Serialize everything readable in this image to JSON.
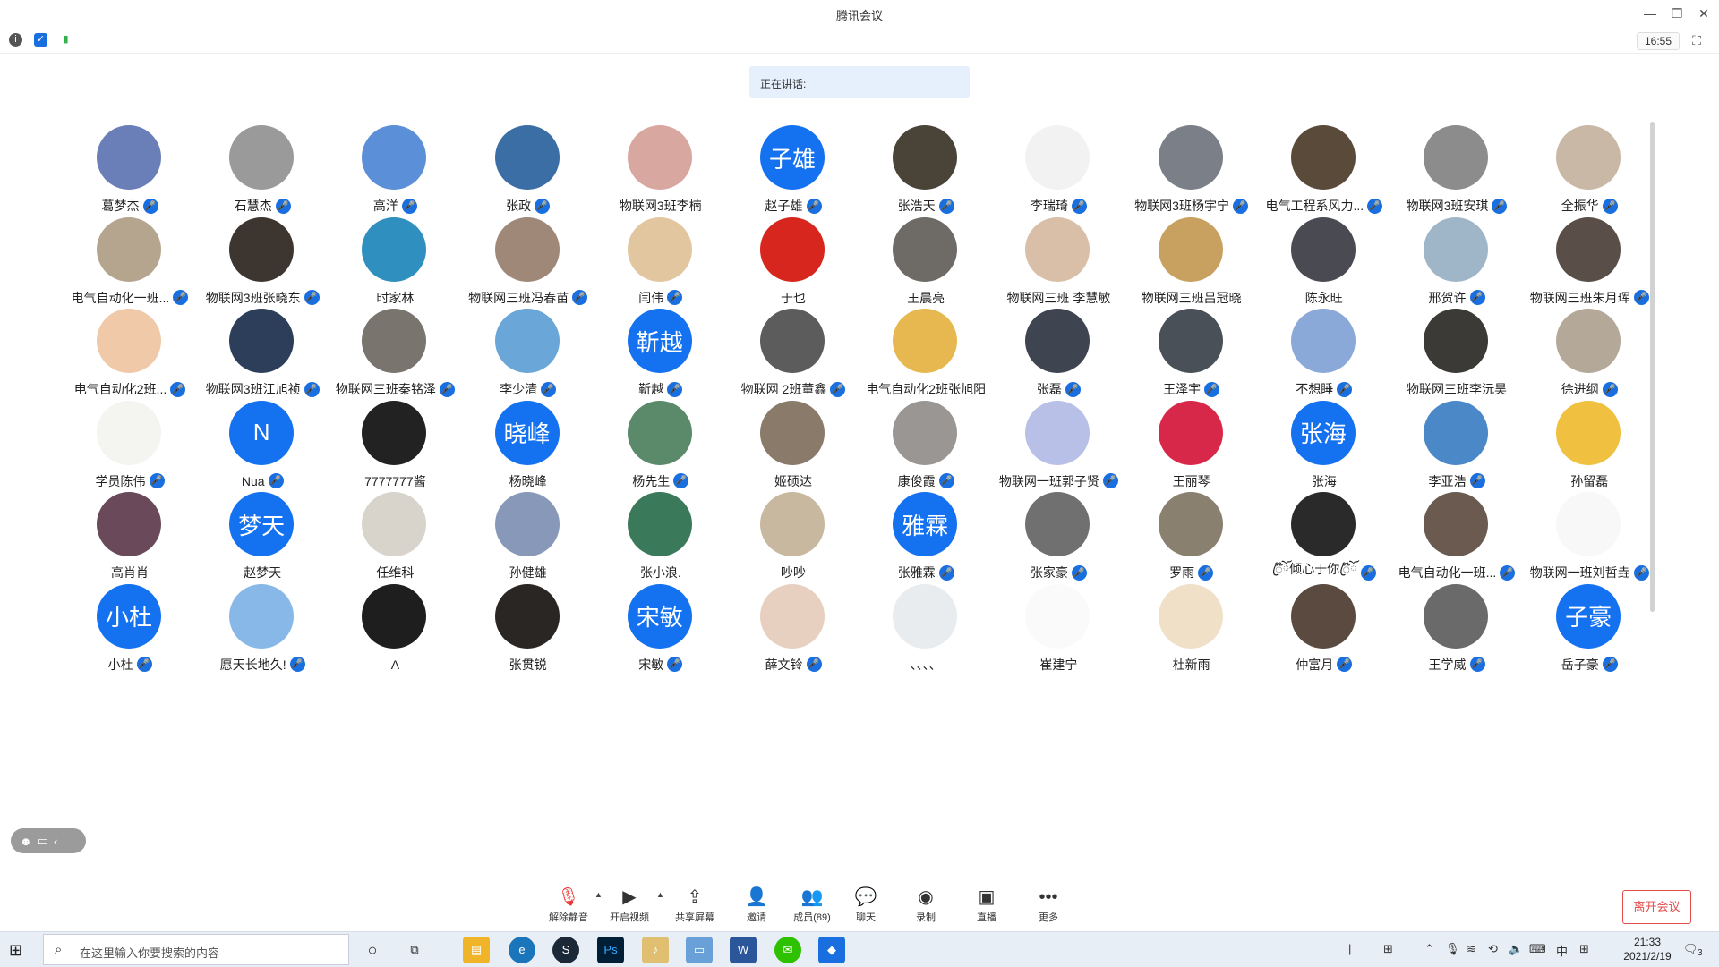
{
  "window": {
    "title": "腾讯会议",
    "minimize": "—",
    "restore": "❐",
    "close": "✕"
  },
  "infobar": {
    "clock": "16:55"
  },
  "speaking": {
    "label": "正在讲话:"
  },
  "participants": [
    {
      "name": "葛梦杰",
      "mic": true,
      "bg": "#6a7fb8"
    },
    {
      "name": "石慧杰",
      "mic": true,
      "bg": "#9a9a9a"
    },
    {
      "name": "高洋",
      "mic": true,
      "bg": "#5b8fd8"
    },
    {
      "name": "张政",
      "mic": true,
      "bg": "#3a6ea5"
    },
    {
      "name": "物联网3班李楠",
      "mic": false,
      "bg": "#d8a7a0"
    },
    {
      "name": "赵子雄",
      "mic": true,
      "avatar_text": "子雄"
    },
    {
      "name": "张浩天",
      "mic": true,
      "bg": "#4a4438"
    },
    {
      "name": "李瑞琦",
      "mic": true,
      "bg": "#f2f2f2"
    },
    {
      "name": "物联网3班杨宇宁",
      "mic": true,
      "bg": "#7b8088"
    },
    {
      "name": "电气工程系风力...",
      "mic": true,
      "bg": "#5a4a3a"
    },
    {
      "name": "物联网3班安琪",
      "mic": true,
      "bg": "#8c8c8c"
    },
    {
      "name": "全振华",
      "mic": true,
      "bg": "#c9b8a6"
    },
    {
      "name": "电气自动化一班...",
      "mic": true,
      "bg": "#b5a58f"
    },
    {
      "name": "物联网3班张晓东",
      "mic": true,
      "bg": "#3d3530"
    },
    {
      "name": "时家林",
      "mic": false,
      "bg": "#2f8fbf"
    },
    {
      "name": "物联网三班冯春苗",
      "mic": true,
      "bg": "#a08878"
    },
    {
      "name": "闫伟",
      "mic": true,
      "bg": "#e2c6a0"
    },
    {
      "name": "于也",
      "mic": false,
      "bg": "#d7261e"
    },
    {
      "name": "王晨亮",
      "mic": false,
      "bg": "#6e6a66"
    },
    {
      "name": "物联网三班 李慧敏",
      "mic": false,
      "bg": "#d9bfa8"
    },
    {
      "name": "物联网三班吕冠晓",
      "mic": false,
      "bg": "#c8a060"
    },
    {
      "name": "陈永旺",
      "mic": false,
      "bg": "#4a4a52"
    },
    {
      "name": "邢贺许",
      "mic": true,
      "bg": "#9fb6c8"
    },
    {
      "name": "物联网三班朱月珲",
      "mic": true,
      "bg": "#5a4e48"
    },
    {
      "name": "电气自动化2班...",
      "mic": true,
      "bg": "#f0c9a8"
    },
    {
      "name": "物联网3班江旭祯",
      "mic": true,
      "bg": "#2c3e5a"
    },
    {
      "name": "物联网三班秦铭泽",
      "mic": true,
      "bg": "#7a746e"
    },
    {
      "name": "李少清",
      "mic": true,
      "bg": "#6aa6d8"
    },
    {
      "name": "靳越",
      "mic": true,
      "avatar_text": "靳越"
    },
    {
      "name": "物联网 2班董鑫",
      "mic": true,
      "bg": "#5c5c5c"
    },
    {
      "name": "电气自动化2班张旭阳",
      "mic": false,
      "bg": "#e8b850"
    },
    {
      "name": "张磊",
      "mic": true,
      "bg": "#3e4450"
    },
    {
      "name": "王泽宇",
      "mic": true,
      "bg": "#4a5058"
    },
    {
      "name": "不想睡",
      "mic": true,
      "bg": "#8aa8d8"
    },
    {
      "name": "物联网三班李沅昊",
      "mic": false,
      "bg": "#3b3a36"
    },
    {
      "name": "徐进纲",
      "mic": true,
      "bg": "#b4a898"
    },
    {
      "name": "学员陈伟",
      "mic": true,
      "bg": "#f4f4f0"
    },
    {
      "name": "Nua",
      "mic": true,
      "avatar_text": "N"
    },
    {
      "name": "7777777酱",
      "mic": false,
      "bg": "#222222"
    },
    {
      "name": "杨晓峰",
      "mic": false,
      "avatar_text": "晓峰"
    },
    {
      "name": "杨先生",
      "mic": true,
      "bg": "#5a8a6a"
    },
    {
      "name": "姬硕达",
      "mic": false,
      "bg": "#8a7a6a"
    },
    {
      "name": "康俊霞",
      "mic": true,
      "bg": "#9a9694"
    },
    {
      "name": "物联网一班郭子贤",
      "mic": true,
      "bg": "#b8c0e8"
    },
    {
      "name": "王丽琴",
      "mic": false,
      "bg": "#d8284a"
    },
    {
      "name": "张海",
      "mic": false,
      "avatar_text": "张海"
    },
    {
      "name": "李亚浩",
      "mic": true,
      "bg": "#4a88c8"
    },
    {
      "name": "孙留磊",
      "mic": false,
      "bg": "#f0c040"
    },
    {
      "name": "高肖肖",
      "mic": false,
      "bg": "#6a4a5a"
    },
    {
      "name": "赵梦天",
      "mic": false,
      "avatar_text": "梦天"
    },
    {
      "name": "任维科",
      "mic": false,
      "bg": "#d8d4cc"
    },
    {
      "name": "孙健雄",
      "mic": false,
      "bg": "#8898b8"
    },
    {
      "name": "张小浪.",
      "mic": false,
      "bg": "#3a7a5a"
    },
    {
      "name": "吵吵",
      "mic": false,
      "bg": "#c8b8a0"
    },
    {
      "name": "张雅霖",
      "mic": true,
      "avatar_text": "雅霖"
    },
    {
      "name": "张家豪",
      "mic": true,
      "bg": "#707070"
    },
    {
      "name": "罗雨",
      "mic": true,
      "bg": "#8a8070"
    },
    {
      "name": "ꦿ໊ོ倾心于你ꦿ໊ོ",
      "mic": true,
      "bg": "#2a2a2a"
    },
    {
      "name": "电气自动化一班...",
      "mic": true,
      "bg": "#6a5a50"
    },
    {
      "name": "物联网一班刘哲垚",
      "mic": true,
      "bg": "#f8f8f8"
    },
    {
      "name": "小杜",
      "mic": true,
      "avatar_text": "小杜"
    },
    {
      "name": "愿天长地久!",
      "mic": true,
      "bg": "#88b8e8"
    },
    {
      "name": "A",
      "mic": false,
      "bg": "#1e1e1e"
    },
    {
      "name": "张贯锐",
      "mic": false,
      "bg": "#2a2624"
    },
    {
      "name": "宋敏",
      "mic": true,
      "avatar_text": "宋敏"
    },
    {
      "name": "薛文铃",
      "mic": true,
      "bg": "#e8d0c0"
    },
    {
      "name": "、、、、",
      "mic": false,
      "bg": "#e8ecee"
    },
    {
      "name": "崔建宁",
      "mic": false,
      "bg": "#fafafa"
    },
    {
      "name": "杜新雨",
      "mic": false,
      "bg": "#f0e0c8"
    },
    {
      "name": "仲富月",
      "mic": true,
      "bg": "#5a4a40"
    },
    {
      "name": "王学威",
      "mic": true,
      "bg": "#6a6a6a"
    },
    {
      "name": "岳子豪",
      "mic": true,
      "avatar_text": "子豪"
    }
  ],
  "toolbar": {
    "unmute": "解除静音",
    "video": "开启视频",
    "share": "共享屏幕",
    "invite": "邀请",
    "members": "成员(89)",
    "chat": "聊天",
    "record": "录制",
    "live": "直播",
    "more": "更多",
    "leave": "离开会议"
  },
  "taskbar": {
    "search_placeholder": "在这里输入你要搜索的内容",
    "time": "21:33",
    "date": "2021/2/19",
    "ime": "中",
    "notifications": "3"
  }
}
